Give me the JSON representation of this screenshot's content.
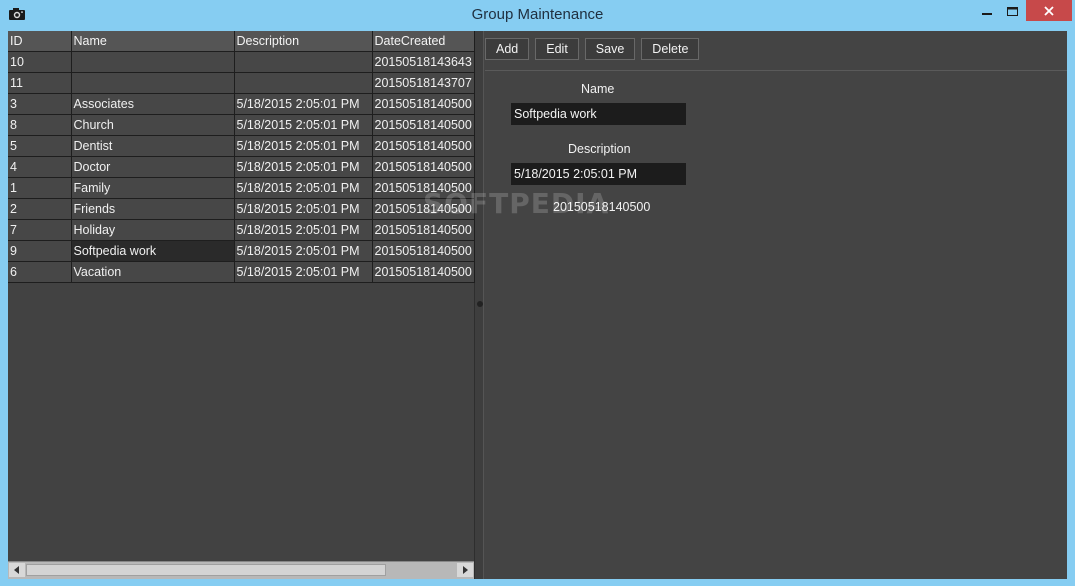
{
  "window": {
    "title": "Group Maintenance",
    "icon": "camera-icon",
    "controls": {
      "minimize": "—",
      "maximize": "☐",
      "close": "✕"
    }
  },
  "grid": {
    "columns": [
      "ID",
      "Name",
      "Description",
      "DateCreated"
    ],
    "rows": [
      [
        "10",
        "",
        "",
        "20150518143643"
      ],
      [
        "11",
        "",
        "",
        "20150518143707"
      ],
      [
        "3",
        "Associates",
        "5/18/2015 2:05:01 PM",
        "20150518140500"
      ],
      [
        "8",
        "Church",
        "5/18/2015 2:05:01 PM",
        "20150518140500"
      ],
      [
        "5",
        "Dentist",
        "5/18/2015 2:05:01 PM",
        "20150518140500"
      ],
      [
        "4",
        "Doctor",
        "5/18/2015 2:05:01 PM",
        "20150518140500"
      ],
      [
        "1",
        "Family",
        "5/18/2015 2:05:01 PM",
        "20150518140500"
      ],
      [
        "2",
        "Friends",
        "5/18/2015 2:05:01 PM",
        "20150518140500"
      ],
      [
        "7",
        "Holiday",
        "5/18/2015 2:05:01 PM",
        "20150518140500"
      ],
      [
        "9",
        "Softpedia work",
        "5/18/2015 2:05:01 PM",
        "20150518140500"
      ],
      [
        "6",
        "Vacation",
        "5/18/2015 2:05:01 PM",
        "20150518140500"
      ]
    ],
    "selected_row_index": 9
  },
  "toolbar": {
    "add_label": "Add",
    "edit_label": "Edit",
    "save_label": "Save",
    "delete_label": "Delete"
  },
  "form": {
    "name_label": "Name",
    "name_value": "Softpedia work",
    "description_label": "Description",
    "description_value": "5/18/2015 2:05:01 PM",
    "date_created": "20150518140500"
  },
  "watermark": "SOFTPEDIA"
}
